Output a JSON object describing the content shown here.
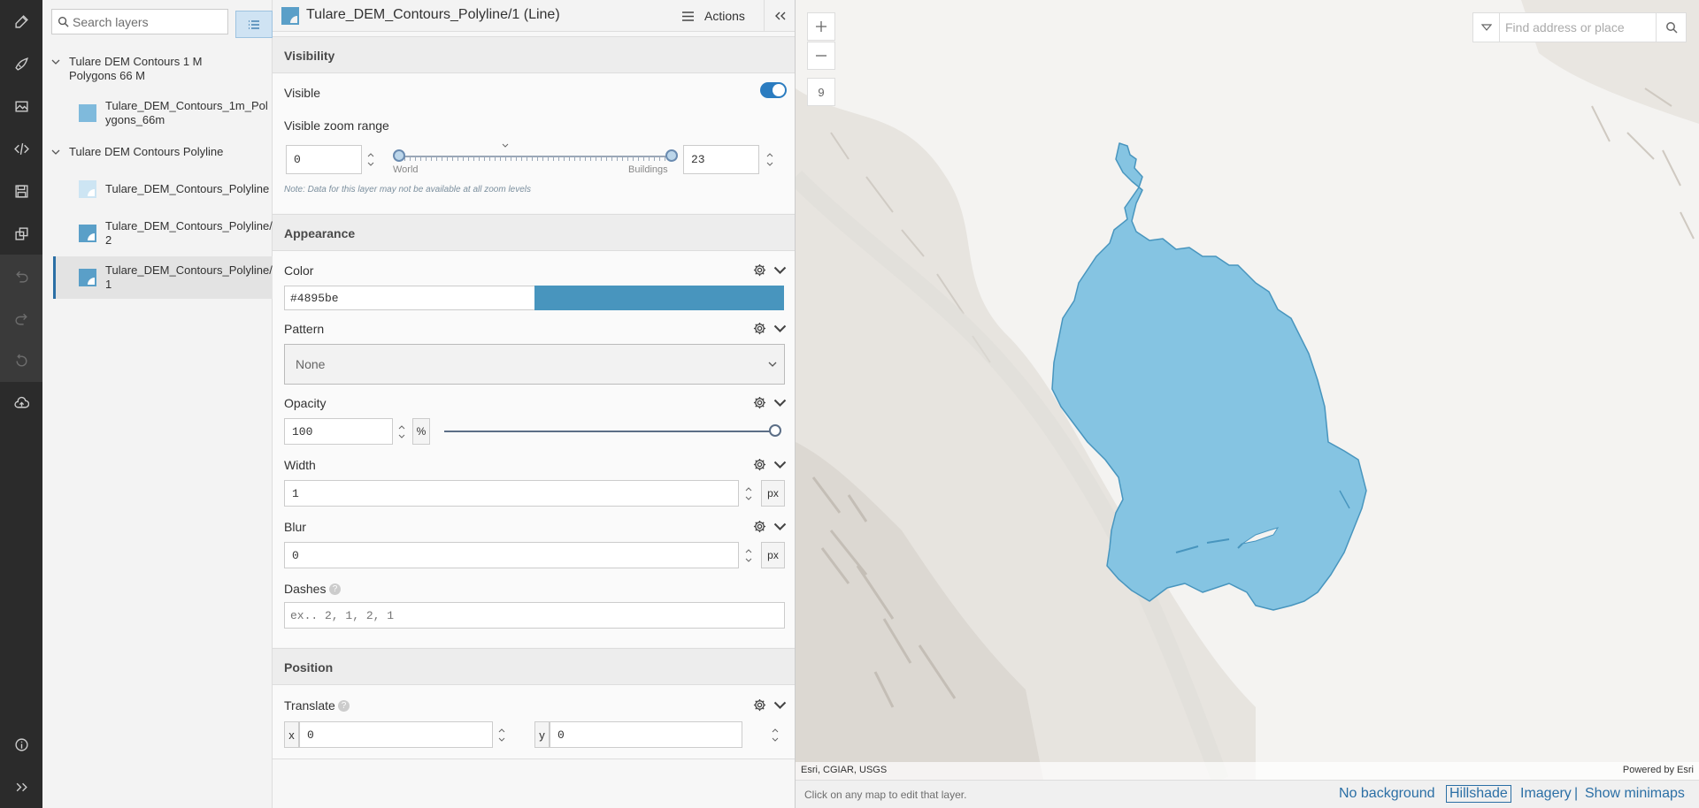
{
  "rail": {
    "icons": [
      "edit-icon",
      "style-icon",
      "image-icon",
      "code-icon",
      "save-icon",
      "copy-icon",
      "undo-icon",
      "redo-icon",
      "reset-icon",
      "upload-icon",
      "info-icon",
      "expand-icon"
    ]
  },
  "layers": {
    "search_placeholder": "Search layers",
    "groups": [
      {
        "label": "Tulare DEM Contours 1 M Polygons 66 M",
        "items": [
          {
            "label": "Tulare_DEM_Contours_1m_Polygons_66m",
            "type": "fill"
          }
        ]
      },
      {
        "label": "Tulare DEM Contours Polyline",
        "items": [
          {
            "label": "Tulare_DEM_Contours_Polyline",
            "type": "line-light"
          },
          {
            "label": "Tulare_DEM_Contours_Polyline/2",
            "type": "line"
          },
          {
            "label": "Tulare_DEM_Contours_Polyline/1",
            "type": "line",
            "selected": true
          }
        ]
      }
    ]
  },
  "panel": {
    "title": "Tulare_DEM_Contours_Polyline/1 (Line)",
    "actions_label": "Actions",
    "visibility": {
      "heading": "Visibility",
      "visible_label": "Visible",
      "visible_on": true,
      "zoom_range_label": "Visible zoom range",
      "min_zoom": "0",
      "max_zoom": "23",
      "min_label": "World",
      "max_label": "Buildings",
      "note": "Note: Data for this layer may not be available at all zoom levels"
    },
    "appearance": {
      "heading": "Appearance",
      "color_label": "Color",
      "color_value": "#4895be",
      "pattern_label": "Pattern",
      "pattern_value": "None",
      "opacity_label": "Opacity",
      "opacity_value": "100",
      "opacity_unit": "%",
      "width_label": "Width",
      "width_value": "1",
      "width_unit": "px",
      "blur_label": "Blur",
      "blur_value": "0",
      "blur_unit": "px",
      "dashes_label": "Dashes",
      "dashes_placeholder": "ex.. 2, 1, 2, 1"
    },
    "position": {
      "heading": "Position",
      "translate_label": "Translate",
      "x_label": "x",
      "x_value": "0",
      "y_label": "y",
      "y_value": "0"
    }
  },
  "map": {
    "zoom_level": "9",
    "geocoder_placeholder": "Find address or place",
    "attribution": "Esri, CGIAR, USGS",
    "powered_by": "Powered by Esri",
    "polygon_color": "#85c4e2",
    "polygon_stroke": "#4895be"
  },
  "footer": {
    "hint": "Click on any map to edit that layer.",
    "basemaps": [
      "No background",
      "Hillshade",
      "Imagery"
    ],
    "active_basemap": "Hillshade",
    "minimaps": "Show minimaps",
    "separator": "|"
  }
}
